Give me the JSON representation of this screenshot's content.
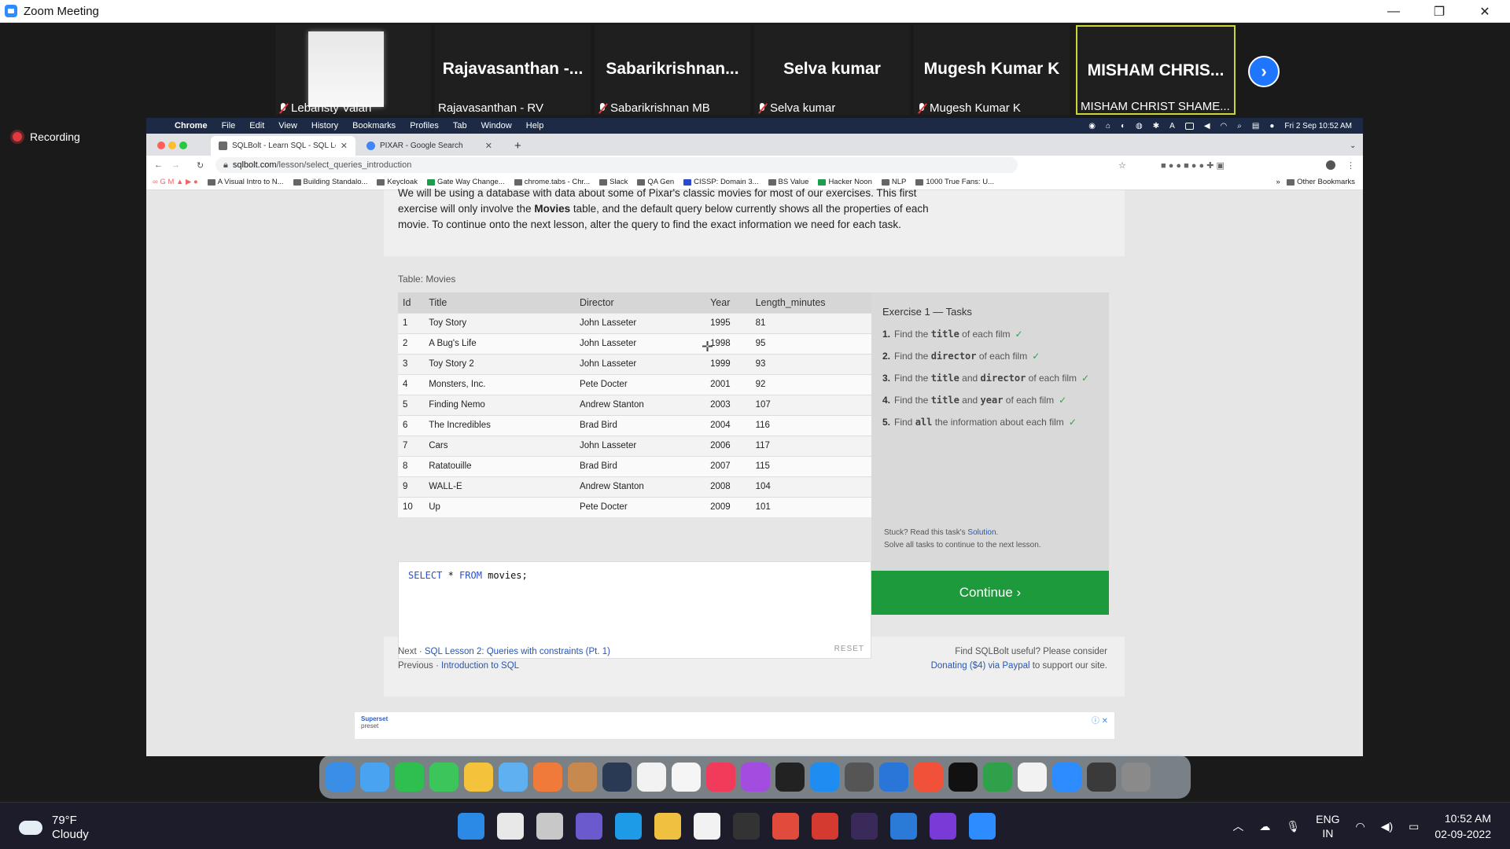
{
  "zoom": {
    "title": "Zoom Meeting",
    "recording": "Recording",
    "participants": [
      {
        "big_name": "",
        "label": "Lebansty Valan",
        "muted": true,
        "photo": true
      },
      {
        "big_name": "Rajavasanthan  -...",
        "label": "Rajavasanthan - RV",
        "muted": false,
        "photo": false
      },
      {
        "big_name": "Sabarikrishnan...",
        "label": "Sabarikrishnan MB",
        "muted": true,
        "photo": false
      },
      {
        "big_name": "Selva kumar",
        "label": "Selva kumar",
        "muted": true,
        "photo": false
      },
      {
        "big_name": "Mugesh Kumar K",
        "label": "Mugesh Kumar K",
        "muted": true,
        "photo": false
      },
      {
        "big_name": "MISHAM  CHRIS...",
        "label": "MISHAM CHRIST SHAME...",
        "muted": false,
        "photo": false,
        "active": true
      }
    ]
  },
  "mac_menu": {
    "items": [
      "Chrome",
      "File",
      "Edit",
      "View",
      "History",
      "Bookmarks",
      "Profiles",
      "Tab",
      "Window",
      "Help"
    ],
    "datetime": "Fri 2 Sep  10:52 AM"
  },
  "chrome": {
    "tabs": [
      {
        "title": "SQLBolt - Learn SQL - SQL Le",
        "active": true
      },
      {
        "title": "PIXAR - Google Search",
        "active": false
      }
    ],
    "new_tab": "+",
    "url_host": "sqlbolt.com",
    "url_path": "/lesson/select_queries_introduction",
    "bookmarks": [
      "A Visual Intro to N...",
      "Building Standalo...",
      "Keycloak",
      "Gate Way Change...",
      "chrome.tabs - Chr...",
      "Slack",
      "QA Gen",
      "CISSP: Domain 3...",
      "BS Value",
      "Hacker Noon",
      "NLP",
      "1000 True Fans: U..."
    ],
    "other_bookmarks": "Other Bookmarks"
  },
  "lesson": {
    "intro_parts": [
      "We will be using a database with data about some of Pixar's classic movies for most of our exercises. This first exercise will only involve the ",
      "Movies",
      " table, and the default query below currently shows all the properties of each movie. To continue onto the next lesson, alter the query to find the exact information we need for each task."
    ],
    "table_caption": "Table: Movies",
    "columns": [
      "Id",
      "Title",
      "Director",
      "Year",
      "Length_minutes"
    ],
    "rows": [
      [
        "1",
        "Toy Story",
        "John Lasseter",
        "1995",
        "81"
      ],
      [
        "2",
        "A Bug's Life",
        "John Lasseter",
        "1998",
        "95"
      ],
      [
        "3",
        "Toy Story 2",
        "John Lasseter",
        "1999",
        "93"
      ],
      [
        "4",
        "Monsters, Inc.",
        "Pete Docter",
        "2001",
        "92"
      ],
      [
        "5",
        "Finding Nemo",
        "Andrew Stanton",
        "2003",
        "107"
      ],
      [
        "6",
        "The Incredibles",
        "Brad Bird",
        "2004",
        "116"
      ],
      [
        "7",
        "Cars",
        "John Lasseter",
        "2006",
        "117"
      ],
      [
        "8",
        "Ratatouille",
        "Brad Bird",
        "2007",
        "115"
      ],
      [
        "9",
        "WALL-E",
        "Andrew Stanton",
        "2008",
        "104"
      ],
      [
        "10",
        "Up",
        "Pete Docter",
        "2009",
        "101"
      ]
    ],
    "query_kw1": "SELECT",
    "query_star": " * ",
    "query_kw2": "FROM",
    "query_rest": " movies;",
    "reset": "RESET",
    "tasks_title": "Exercise 1 — Tasks",
    "tasks": [
      {
        "num": "1.",
        "pre": "Find the ",
        "code": "title",
        "post": " of each film"
      },
      {
        "num": "2.",
        "pre": "Find the ",
        "code": "director",
        "post": " of each film"
      },
      {
        "num": "3.",
        "pre": "Find the ",
        "code": "title",
        "mid": " and ",
        "code2": "director",
        "post": " of each film"
      },
      {
        "num": "4.",
        "pre": "Find the ",
        "code": "title",
        "mid": " and ",
        "code2": "year",
        "post": " of each film"
      },
      {
        "num": "5.",
        "pre": "Find ",
        "code": "all",
        "post": " the information about each film"
      }
    ],
    "check": "✓",
    "stuck_pre": "Stuck? Read this task's ",
    "stuck_link": "Solution",
    "stuck_post": ".",
    "stuck_line2": "Solve all tasks to continue to the next lesson.",
    "continue": "Continue ›",
    "next_label": "Next",
    "next_link": "SQL Lesson 2: Queries with constraints (Pt. 1)",
    "prev_label": "Previous",
    "prev_link": "Introduction to SQL",
    "useful": "Find SQLBolt useful? Please consider",
    "donate_link": "Donating ($4) via Paypal",
    "donate_post": " to support our site."
  },
  "ad": {
    "brand1": "Superset",
    "brand2": "preset",
    "close": "ⓘ ✕"
  },
  "taskbar": {
    "temp": "79°F",
    "condition": "Cloudy",
    "lang1": "ENG",
    "lang2": "IN",
    "time": "10:52 AM",
    "date": "02-09-2022"
  },
  "colors": {
    "accent": "#1d9a3b",
    "zoom_blue": "#2d8cff",
    "link": "#2457b8"
  }
}
